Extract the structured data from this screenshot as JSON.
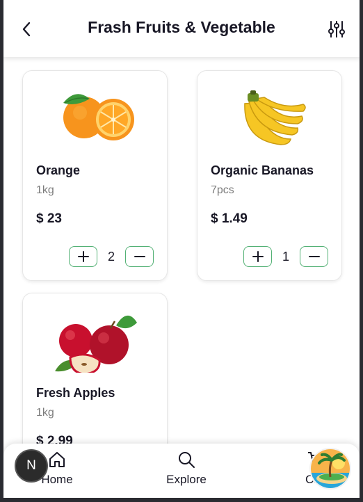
{
  "header": {
    "title": "Frash Fruits & Vegetable"
  },
  "products": [
    {
      "name": "Orange",
      "unit": "1kg",
      "price": "$ 23",
      "quantity": "2"
    },
    {
      "name": "Organic Bananas",
      "unit": "7pcs",
      "price": "$ 1.49",
      "quantity": "1"
    },
    {
      "name": "Fresh Apples",
      "unit": "1kg",
      "price": "$ 2.99"
    }
  ],
  "bottom_nav": {
    "home": "Home",
    "explore": "Explore",
    "cart": "Cart"
  },
  "overlay": {
    "avatar_letter": "N"
  },
  "colors": {
    "accent": "#53b175",
    "text": "#181725",
    "muted": "#7c7c7c"
  }
}
